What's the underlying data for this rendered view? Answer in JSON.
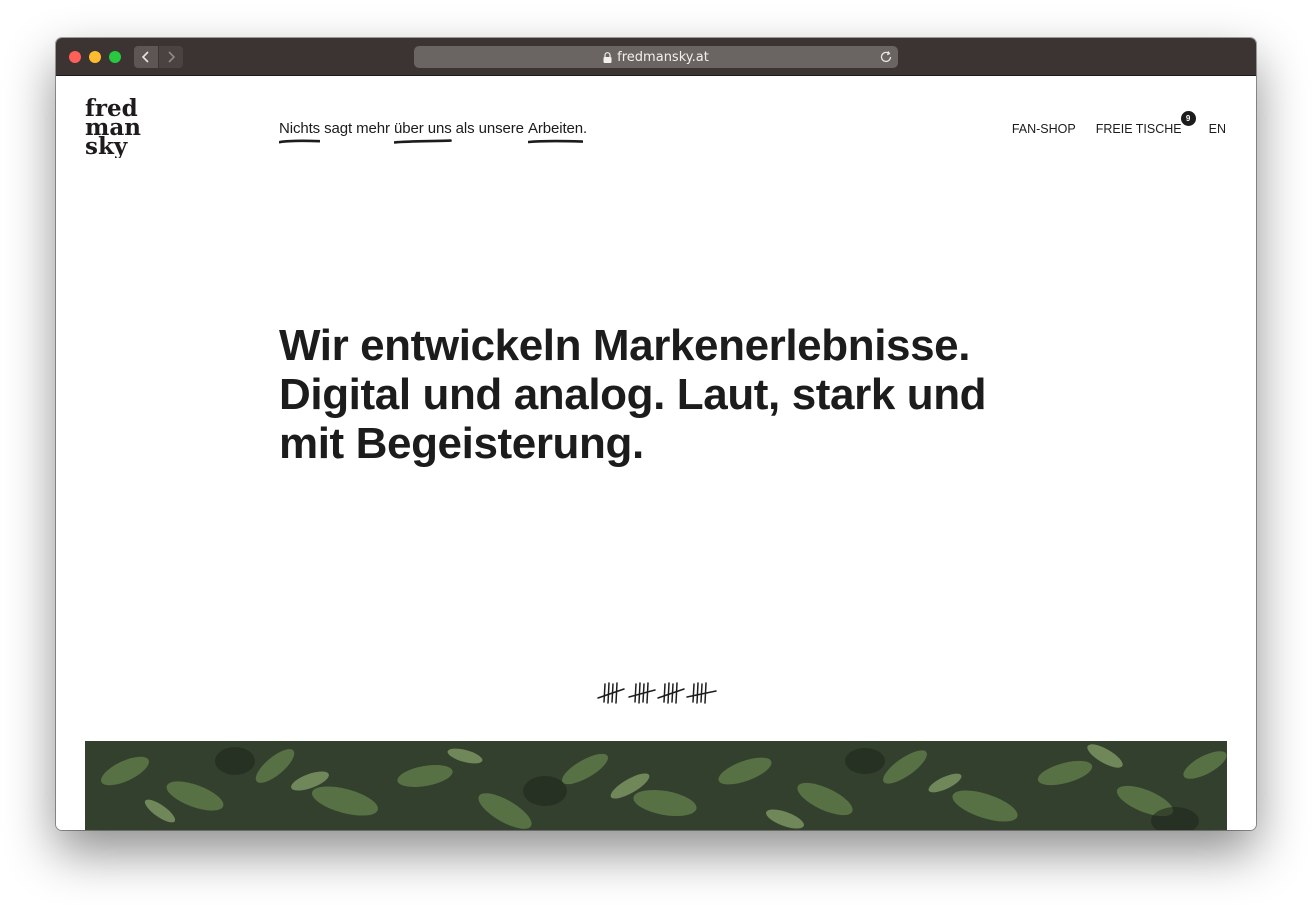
{
  "browser": {
    "url": "fredmansky.at"
  },
  "site": {
    "logo_text": [
      "fred",
      "man",
      "sky"
    ],
    "tagline": {
      "part1": "Nichts",
      "part2": " sagt mehr ",
      "part3": "über uns",
      "part4": " als unsere ",
      "part5": "Arbeiten",
      "part6": "."
    },
    "nav": {
      "fanshop": "FAN-SHOP",
      "freie_tische": "FREIE TISCHE",
      "freie_tische_count": "9",
      "lang": "EN"
    },
    "hero": {
      "line1": "Wir entwickeln Markenerlebnisse.",
      "line2": "Digital und analog. Laut, stark und",
      "line3": "mit Begeisterung."
    },
    "colors": {
      "text": "#1c1c1c",
      "toolbar": "#3c3432"
    }
  }
}
